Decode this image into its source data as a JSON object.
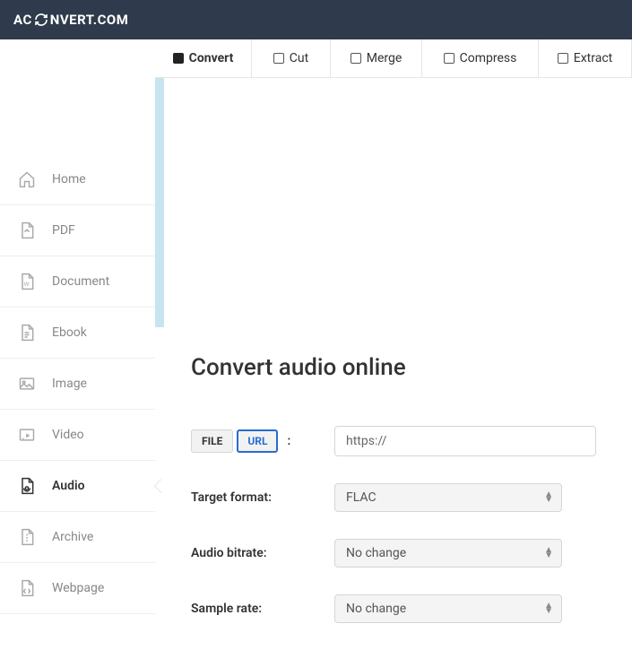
{
  "brand": {
    "prefix": "AC",
    "suffix": "NVERT.COM"
  },
  "tabs": [
    {
      "label": "Convert",
      "active": true
    },
    {
      "label": "Cut",
      "active": false
    },
    {
      "label": "Merge",
      "active": false
    },
    {
      "label": "Compress",
      "active": false
    },
    {
      "label": "Extract",
      "active": false
    }
  ],
  "sidebar": [
    {
      "label": "Home",
      "icon": "home",
      "active": false
    },
    {
      "label": "PDF",
      "icon": "pdf",
      "active": false
    },
    {
      "label": "Document",
      "icon": "doc",
      "active": false
    },
    {
      "label": "Ebook",
      "icon": "ebook",
      "active": false
    },
    {
      "label": "Image",
      "icon": "image",
      "active": false
    },
    {
      "label": "Video",
      "icon": "video",
      "active": false
    },
    {
      "label": "Audio",
      "icon": "audio",
      "active": true
    },
    {
      "label": "Archive",
      "icon": "archive",
      "active": false
    },
    {
      "label": "Webpage",
      "icon": "webpage",
      "active": false
    }
  ],
  "page": {
    "title": "Convert audio online",
    "source": {
      "file_btn": "FILE",
      "url_btn": "URL",
      "active": "url",
      "url_value": "https://"
    },
    "fields": {
      "target_format": {
        "label": "Target format:",
        "value": "FLAC"
      },
      "audio_bitrate": {
        "label": "Audio bitrate:",
        "value": "No change"
      },
      "sample_rate": {
        "label": "Sample rate:",
        "value": "No change"
      }
    }
  }
}
